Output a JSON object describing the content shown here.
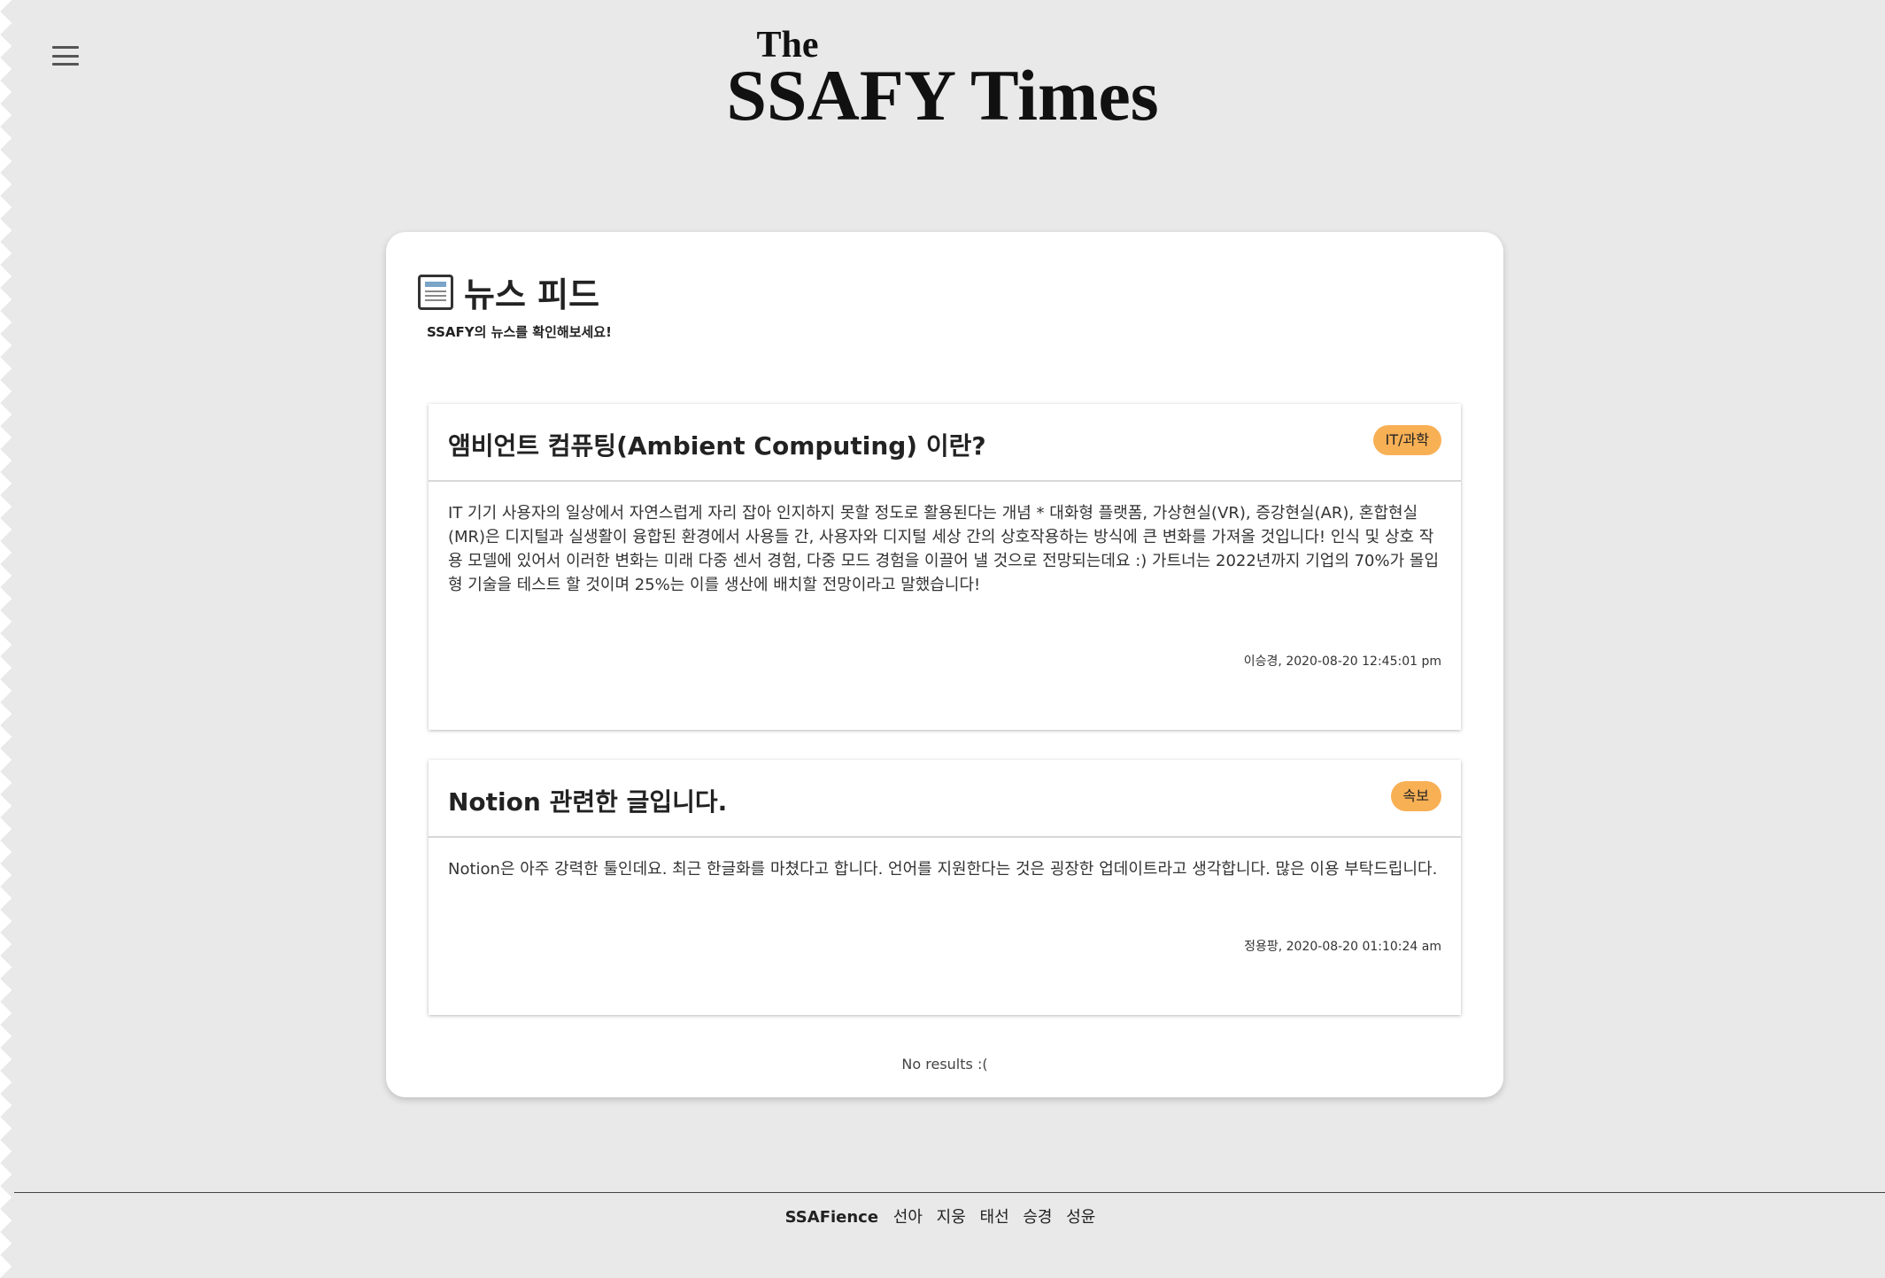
{
  "header": {
    "masthead_the": "The",
    "masthead_name": "SSAFY Times",
    "menu_icon": "hamburger-menu-icon"
  },
  "feed": {
    "title": "뉴스 피드",
    "icon": "newspaper-icon",
    "subtitle": "SSAFY의 뉴스를 확인해보세요!",
    "articles": [
      {
        "title": "앰비언트 컴퓨팅(Ambient Computing) 이란?",
        "tag": "IT/과학",
        "body": "IT 기기 사용자의 일상에서 자연스럽게 자리 잡아 인지하지 못할 정도로 활용된다는 개념 * 대화형 플랫폼, 가상현실(VR), 증강현실(AR), 혼합현실(MR)은 디지털과 실생활이 융합된 환경에서 사용들 간, 사용자와 디지털 세상 간의 상호작용하는 방식에 큰 변화를 가져올 것입니다! 인식 및 상호 작용 모델에 있어서 이러한 변화는 미래 다중 센서 경험, 다중 모드 경험을 이끌어 낼 것으로 전망되는데요 :) 가트너는 2022년까지 기업의 70%가 몰입형 기술을 테스트 할 것이며 25%는 이를 생산에 배치할 전망이라고 말했습니다!",
        "meta": "이승경, 2020-08-20 12:45:01 pm"
      },
      {
        "title": "Notion 관련한 글입니다.",
        "tag": "속보",
        "body": "Notion은 아주 강력한 툴인데요. 최근 한글화를 마쳤다고 합니다. 언어를 지원한다는 것은 굉장한 업데이트라고 생각합니다. 많은 이용 부탁드립니다.",
        "meta": "정용팡, 2020-08-20 01:10:24 am"
      }
    ],
    "empty_message": "No results :("
  },
  "footer": {
    "brand": "SSAFience",
    "members": [
      "선아",
      "지웅",
      "태선",
      "승경",
      "성윤"
    ]
  },
  "colors": {
    "background": "#e9e9e9",
    "tag": "#f8b055"
  }
}
